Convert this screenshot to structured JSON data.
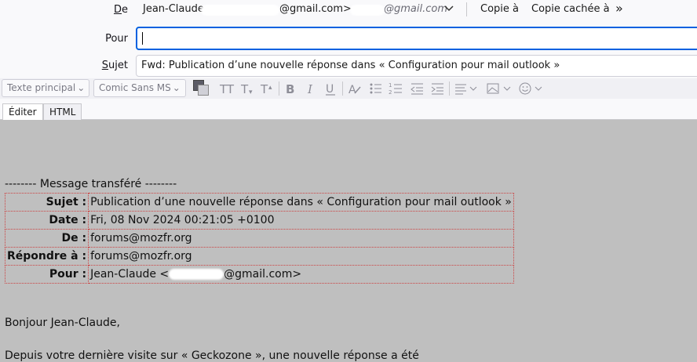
{
  "header": {
    "from_label": "De",
    "from_name": "Jean-Claude",
    "from_email_suffix": "@gmail.com>",
    "from_alias_suffix": "@gmail.com",
    "cc_label": "Copie à",
    "bcc_label": "Copie cachée à",
    "more_label": "»",
    "to_label": "Pour",
    "to_value": "",
    "subject_label": "Sujet",
    "subject_value": "Fwd: Publication d’une nouvelle réponse dans « Configuration pour mail outlook »"
  },
  "toolbar": {
    "paragraph_format": "Texte principal",
    "font": "Comic Sans MS",
    "icons": [
      "text-color-icon",
      "font-smaller-icon",
      "font-larger-icon",
      "bold-icon",
      "italic-icon",
      "underline-icon",
      "clear-format-icon",
      "bullet-list-icon",
      "numbered-list-icon",
      "outdent-icon",
      "indent-icon",
      "align-icon",
      "insert-icon",
      "emoji-icon"
    ]
  },
  "tabs": [
    {
      "label": "Éditer",
      "active": true
    },
    {
      "label": "HTML",
      "active": false
    }
  ],
  "message": {
    "forward_header": "-------- Message transféré --------",
    "rows": [
      {
        "key": "Sujet :",
        "value": "Publication d’une nouvelle réponse dans « Configuration pour mail outlook »"
      },
      {
        "key": "Date :",
        "value": "Fri, 08 Nov 2024 00:21:05 +0100"
      },
      {
        "key": "De :",
        "value": "forums@mozfr.org"
      },
      {
        "key": "Répondre à :",
        "value": "forums@mozfr.org"
      },
      {
        "key": "Pour :",
        "value_prefix": "Jean-Claude <",
        "value_suffix": "@gmail.com>"
      }
    ],
    "greeting": "Bonjour Jean-Claude,",
    "body_line": "Depuis votre dernière visite sur « Geckozone », une nouvelle réponse a été"
  },
  "colors": {
    "focus_border": "#0061e0",
    "editor_background": "#bfbfbf",
    "table_border": "#cc4444"
  }
}
